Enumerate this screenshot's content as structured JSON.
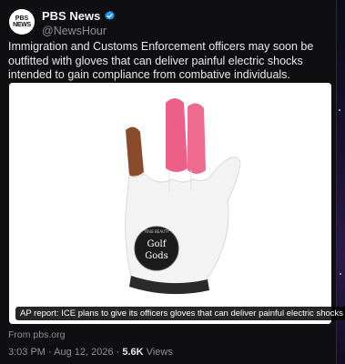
{
  "account": {
    "display_name": "PBS News",
    "handle": "@NewsHour",
    "avatar_line1": "PBS",
    "avatar_line2": "NEWS"
  },
  "tweet": {
    "text": "Immigration and Customs Enforcement officers may soon be outfitted with gloves that can deliver painful electric shocks intended to gain compliance from combative individuals."
  },
  "card": {
    "caption": "AP report: ICE plans to give its officers gloves that can deliver painful electric shocks",
    "source": "From pbs.org",
    "patch_text_top": "Golf",
    "patch_text_bottom": "Gods",
    "patch_ring_text": "TRUE BEAUTY"
  },
  "meta": {
    "time": "3:03 PM",
    "separator": " · ",
    "date": "Aug 12, 2026",
    "views_count": "5.6K",
    "views_label": " Views"
  },
  "colors": {
    "pink_finger": "#ec5f86",
    "brown_finger": "#8a4a2c",
    "verified": "#1d9bf0"
  },
  "icons": [
    "verified-badge-icon",
    "more-options-icon"
  ]
}
